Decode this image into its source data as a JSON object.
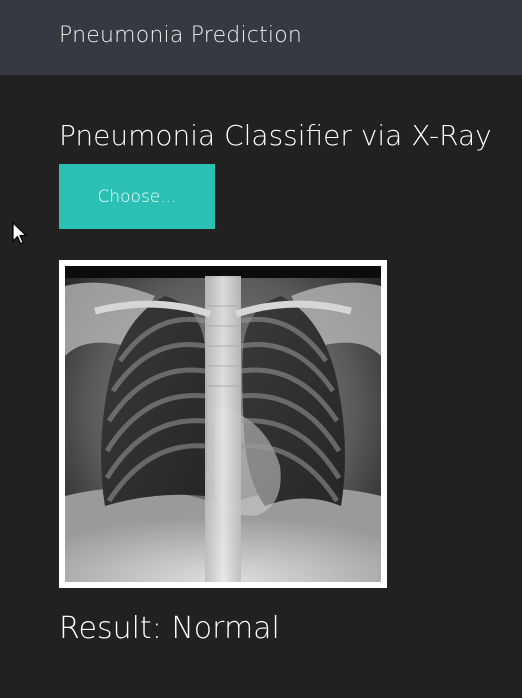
{
  "navbar": {
    "brand": "Pneumonia Prediction"
  },
  "main": {
    "heading": "Pneumonia Classifier via X-Ray",
    "choose_button_label": "Choose...",
    "image_icon": "chest-xray-image",
    "result_text": "Result: Normal"
  },
  "colors": {
    "background": "#212121",
    "navbar": "#343a40",
    "accent": "#2bc0b4"
  }
}
